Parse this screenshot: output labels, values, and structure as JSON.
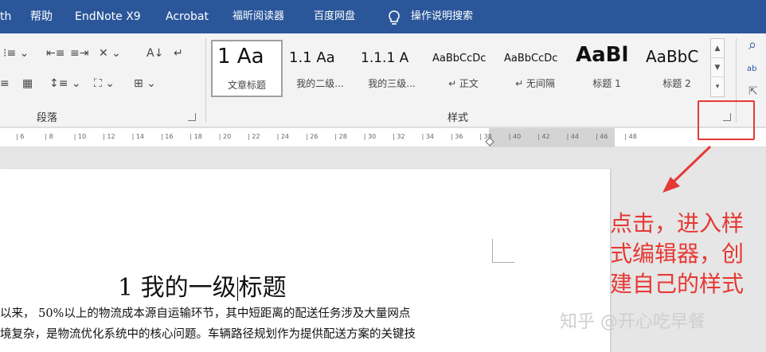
{
  "menu": {
    "items": [
      "th",
      "帮助",
      "EndNote X9",
      "Acrobat",
      "福昕阅读器",
      "百度网盘"
    ],
    "search_label": "操作说明搜索"
  },
  "ribbon": {
    "paragraph_group_label": "段落",
    "styles_group_label": "样式",
    "styles": [
      {
        "preview": "1  Aa",
        "name": "文章标题",
        "selected": true
      },
      {
        "preview": "1.1  Aa",
        "name": "我的二级..."
      },
      {
        "preview": "1.1.1  A",
        "name": "我的三级..."
      },
      {
        "preview": "AaBbCcDc",
        "name": "↵ 正文"
      },
      {
        "preview": "AaBbCcDc",
        "name": "↵ 无间隔"
      },
      {
        "preview": "AaBl",
        "name": "标题 1"
      },
      {
        "preview": "AaBbC",
        "name": "标题 2"
      }
    ]
  },
  "ruler": {
    "ticks": [
      "6",
      "8",
      "10",
      "12",
      "14",
      "16",
      "18",
      "20",
      "22",
      "24",
      "26",
      "28",
      "30",
      "32",
      "34",
      "36",
      "38",
      "40",
      "42",
      "44",
      "46",
      "48"
    ]
  },
  "document": {
    "heading_before_cursor": "1 我的一级",
    "heading_after_cursor": "标题",
    "body_lines": [
      "以来， 50%以上的物流成本源自运输环节，其中短距离的配送任务涉及大量网点",
      "境复杂，是物流优化系统中的核心问题。车辆路径规划作为提供配送方案的关键技"
    ]
  },
  "annotation": {
    "callout_lines": [
      "点击，进入样",
      "式编辑器，创",
      "建自己的样式"
    ],
    "color": "#e53935"
  },
  "watermark": "知乎 @开心吃早餐",
  "colors": {
    "titlebar": "#2b579a",
    "ribbon": "#f3f3f3",
    "annotation": "#e53935"
  }
}
